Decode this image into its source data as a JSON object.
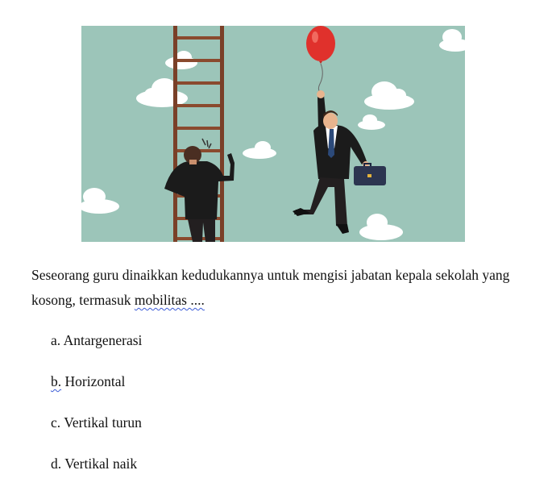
{
  "illustration": {
    "icon": "businessman-ladder-balloon-illustration",
    "background_color": "#9cc5b9",
    "balloon_color": "#e0312c",
    "ladder_color": "#7a4028",
    "briefcase_color": "#2c3550"
  },
  "question": {
    "text_part1": "Seseorang guru dinaikkan kedudukannya untuk mengisi jabatan kepala sekolah yang kosong, termasuk ",
    "text_flagged": "mobilitas ....",
    "spellcheck_color": "#3b5bd6"
  },
  "options": {
    "a": {
      "letter": "a.",
      "text": "Antargenerasi"
    },
    "b": {
      "letter": "b.",
      "text": "Horizontal"
    },
    "c": {
      "letter": "c.",
      "text": "Vertikal turun"
    },
    "d": {
      "letter": "d.",
      "text": "Vertikal naik"
    }
  }
}
